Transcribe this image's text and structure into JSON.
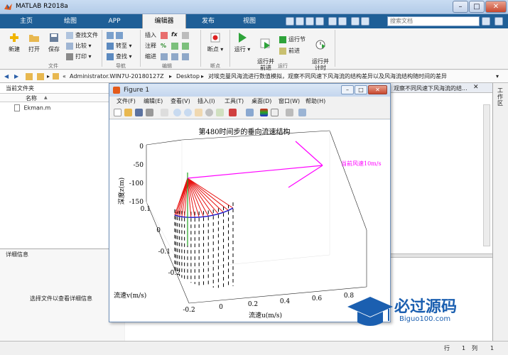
{
  "window": {
    "title": "MATLAB R2018a"
  },
  "tabs": [
    {
      "label": "主页"
    },
    {
      "label": "绘图"
    },
    {
      "label": "APP"
    },
    {
      "label": "编辑器"
    },
    {
      "label": "发布"
    },
    {
      "label": "视图"
    }
  ],
  "search": {
    "placeholder": "搜索文档"
  },
  "ribbon": {
    "new_label": "新建",
    "open_label": "打开",
    "save_label": "保存",
    "find_files_label": "查找文件",
    "compare_label": "比较",
    "print_label": "打印",
    "goto_label": "转至",
    "find_label": "查找",
    "insert_label": "插入",
    "comment_label": "注释",
    "indent_label": "缩进",
    "breakpoint_label": "断点",
    "run_label": "运行",
    "run_advance_label": "运行并\n前进",
    "run_section_label": "运行节",
    "advance_label": "前进",
    "run_time_label": "运行并\n计时",
    "group_file": "文件",
    "group_nav": "导航",
    "group_edit": "编辑",
    "group_breakpoints": "断点",
    "group_run": "运行"
  },
  "address": {
    "path_parts": [
      "Administrator.WIN7U-20180127Z",
      "Desktop",
      "对埃克曼风海流进行数值模拟，观察不同风速下风海流的结构差异以及风海流结构随时间的差异"
    ],
    "behind_text": "观察不同风速下风海流的结..."
  },
  "left_panel": {
    "title": "当前文件夹",
    "name_header": "名称",
    "sort_arrow": "▲",
    "files": [
      {
        "name": "Ekman.m"
      }
    ]
  },
  "details": {
    "title": "详细信息",
    "message": "选择文件以查看详细信息"
  },
  "right_strip": {
    "label": "工作区"
  },
  "status": {
    "row_label": "行",
    "row_value": "1",
    "col_label": "列",
    "col_value": "1"
  },
  "figure": {
    "title": "Figure 1",
    "menu": [
      "文件(F)",
      "编辑(E)",
      "查看(V)",
      "插入(I)",
      "工具(T)",
      "桌面(D)",
      "窗口(W)",
      "帮助(H)"
    ]
  },
  "chart_data": {
    "type": "line",
    "title": "第480时间步的垂向流速结构",
    "xlabel": "流速u(m/s)",
    "ylabel": "流速v(m/s)",
    "zlabel": "深度z(m)",
    "annotation": "当前风速10m/s",
    "x_ticks": [
      "-0.2",
      "0",
      "0.2",
      "0.4",
      "0.6",
      "0.8"
    ],
    "y_ticks": [
      "-0.2",
      "-0.1",
      "0",
      "0.1"
    ],
    "z_ticks": [
      "0",
      "-50",
      "-100",
      "-150"
    ],
    "depths": [
      0,
      -10,
      -20,
      -30,
      -40,
      -50,
      -60,
      -70,
      -80,
      -90,
      -100,
      -110,
      -120,
      -130,
      -140,
      -150,
      -160
    ],
    "colors": {
      "wind_arrow": "#ff00ff",
      "profile_lines": "#e8110f",
      "hodograph": "#1a14c8",
      "surface_line": "#22a422"
    }
  },
  "watermark": {
    "text": "必过源码",
    "sub": "Biguo100.com"
  }
}
